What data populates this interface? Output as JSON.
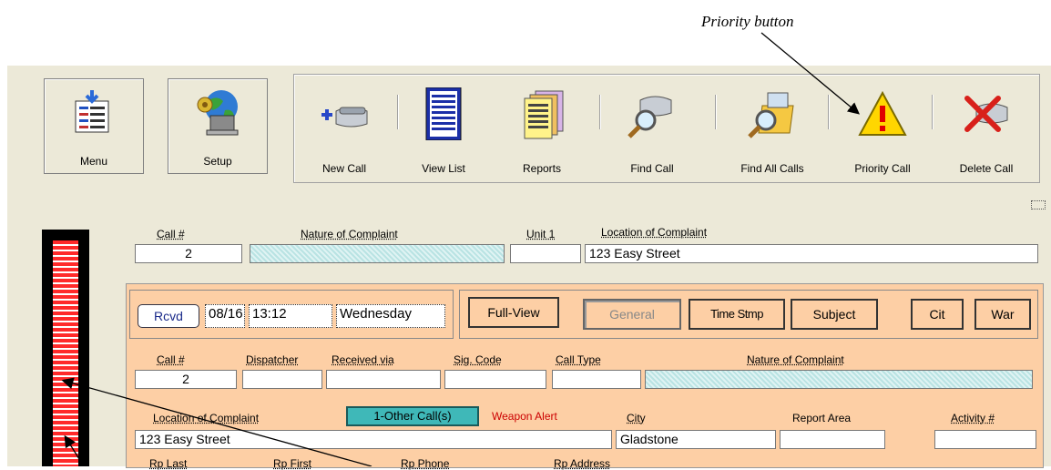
{
  "caption": "Priority button",
  "toolbar": {
    "menu_label": "Menu",
    "setup_label": "Setup",
    "items": [
      {
        "label": "New Call",
        "icon": "new-call-phone-icon"
      },
      {
        "label": "View List",
        "icon": "view-list-icon"
      },
      {
        "label": "Reports",
        "icon": "reports-icon"
      },
      {
        "label": "Find Call",
        "icon": "find-call-icon"
      },
      {
        "label": "Find All Calls",
        "icon": "find-all-calls-icon"
      },
      {
        "label": "Priority Call",
        "icon": "warning-icon"
      },
      {
        "label": "Delete Call",
        "icon": "delete-call-icon"
      }
    ]
  },
  "top_row": {
    "call_no_label": "Call #",
    "call_no_value": "2",
    "nature_label": "Nature of Complaint",
    "nature_value": "",
    "unit_label": "Unit 1",
    "unit_value": "",
    "location_label": "Location of Complaint",
    "location_value": "123 Easy Street"
  },
  "received": {
    "button": "Rcvd",
    "date": "08/16",
    "time": "13:12",
    "day": "Wednesday"
  },
  "view_buttons": [
    "Full-View",
    "General",
    "Time Stmp",
    "Subject",
    "Cit",
    "War"
  ],
  "detail": {
    "call_no_label": "Call #",
    "call_no_value": "2",
    "dispatcher_label": "Dispatcher",
    "received_via_label": "Received via",
    "sig_code_label": "Sig. Code",
    "call_type_label": "Call Type",
    "nature_label": "Nature of Complaint",
    "location_label": "Location of Complaint",
    "other_calls_button": "1-Other Call(s)",
    "weapon_alert": "Weapon Alert",
    "city_label": "City",
    "city_value": "Gladstone",
    "report_area_label": "Report Area",
    "activity_label": "Activity #",
    "location_value": "123 Easy Street",
    "rp_last": "Rp Last",
    "rp_first": "Rp First",
    "rp_phone": "Rp Phone",
    "rp_address": "Rp Address"
  },
  "colors": {
    "panel": "#fdcfa5",
    "toolbar_bg": "#ece9d8",
    "weapon_alert": "#cc0000",
    "other_calls_bg": "#3fb8b8",
    "meter_red": "#ff2a2a"
  }
}
